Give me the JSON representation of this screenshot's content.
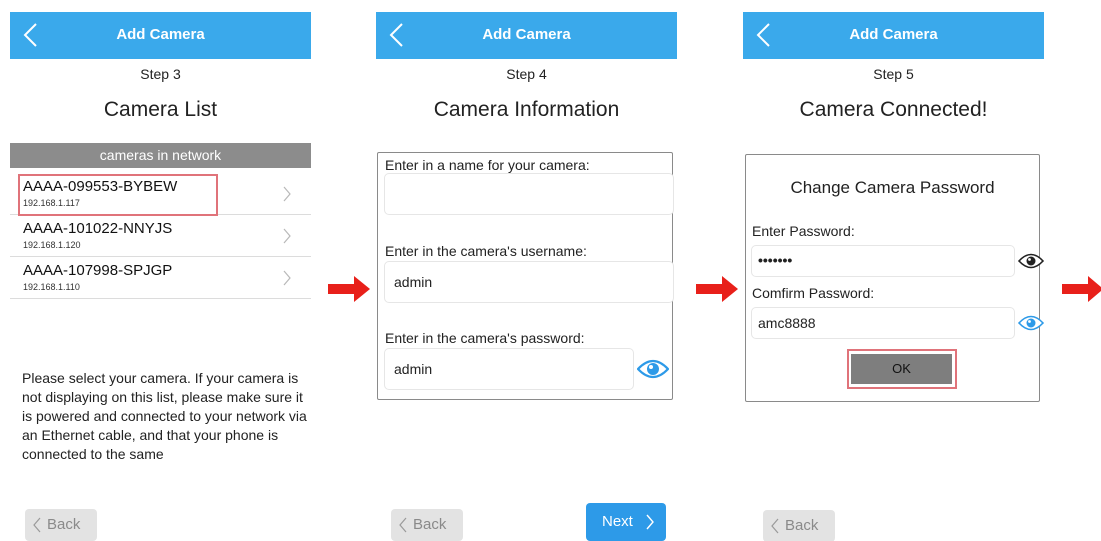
{
  "screen1": {
    "title": "Add Camera",
    "step": "Step 3",
    "heading": "Camera List",
    "section_header": "cameras in network",
    "cameras": [
      {
        "name": "AAAA-099553-BYBEW",
        "ip": "192.168.1.117"
      },
      {
        "name": "AAAA-101022-NNYJS",
        "ip": "192.168.1.120"
      },
      {
        "name": "AAAA-107998-SPJGP",
        "ip": "192.168.1.110"
      }
    ],
    "instructions": "Please select your camera. If your camera is not displaying on this list, please make sure it is powered and connected to your network via an Ethernet cable, and that your phone is connected to the same",
    "back_label": "Back"
  },
  "screen2": {
    "title": "Add Camera",
    "step": "Step 4",
    "heading": "Camera Information",
    "name_label": "Enter in a name for your camera:",
    "name_value": "",
    "username_label": "Enter in the camera's username:",
    "username_value": "admin",
    "password_label": "Enter in the camera's password:",
    "password_value": "admin",
    "back_label": "Back",
    "next_label": "Next"
  },
  "screen3": {
    "title": "Add Camera",
    "step": "Step 5",
    "heading": "Camera Connected!",
    "card_title": "Change Camera Password",
    "enter_label": "Enter Password:",
    "enter_value": "•••••••",
    "confirm_label": "Comfirm Password:",
    "confirm_value": "amc8888",
    "ok_label": "OK",
    "back_label": "Back"
  },
  "colors": {
    "topbar": "#3aa9eb",
    "next_button": "#2d9ae8",
    "arrow": "#e8201a",
    "highlight": "#e0737a",
    "section_header": "#8c8c8c",
    "ok_button": "#7e7e7e"
  },
  "icons": [
    "chevron-left-icon",
    "chevron-right-icon",
    "eye-icon",
    "red-arrow-icon"
  ]
}
